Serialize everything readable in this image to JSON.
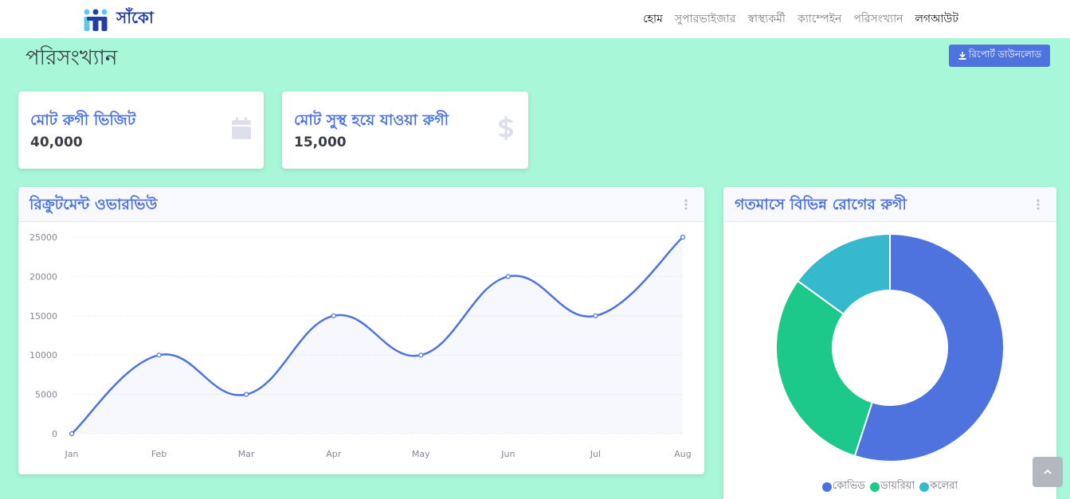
{
  "navbar": {
    "brand": "সাঁকো",
    "links": [
      {
        "label": "হোম"
      },
      {
        "label": "সুপারভাইজার"
      },
      {
        "label": "স্বাস্থ্যকর্মী"
      },
      {
        "label": "ক্যাম্পেইন"
      },
      {
        "label": "পরিসংখ্যান"
      },
      {
        "label": "লগআউট"
      }
    ]
  },
  "page": {
    "title": "পরিসংখ্যান",
    "download_label": "রিপোর্ট ডাউনলোড"
  },
  "cards": [
    {
      "label": "মোট রুগী ভিজিট",
      "value": "40,000",
      "icon": "calendar-icon"
    },
    {
      "label": "মোট সুস্থ হয়ে যাওয়া রুগী",
      "value": "15,000",
      "icon": "dollar-icon"
    }
  ],
  "panels": {
    "line_title": "রিক্রুটমেন্ট ওভারভিউ",
    "donut_title": "গতমাসে বিভিন্ন রোগের রুগী"
  },
  "colors": {
    "primary": "#4e73df",
    "success": "#1cc88a",
    "info": "#36b9cc",
    "background": "#a8f7d8"
  },
  "chart_data": [
    {
      "type": "line",
      "x": [
        "Jan",
        "Feb",
        "Mar",
        "Apr",
        "May",
        "Jun",
        "Jul",
        "Aug"
      ],
      "series": [
        {
          "values": [
            0,
            10000,
            5000,
            15000,
            10000,
            20000,
            15000,
            25000
          ]
        }
      ],
      "yticks": [
        "0",
        "5000",
        "10000",
        "15000",
        "20000",
        "25000"
      ],
      "ylim": [
        0,
        25000
      ],
      "grid": true
    },
    {
      "type": "pie",
      "labels": [
        "কোভিড",
        "ডায়রিয়া",
        "কলেরা"
      ],
      "values": [
        55,
        30,
        15
      ],
      "colors": [
        "#4e73df",
        "#1cc88a",
        "#36b9cc"
      ],
      "legend": "bottom"
    }
  ]
}
